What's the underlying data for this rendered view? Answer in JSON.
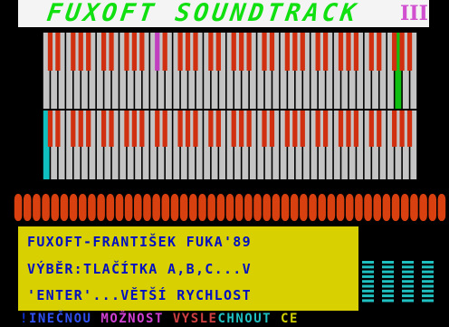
{
  "title": {
    "text": "FUXOFT SOUNDTRACK",
    "numeral": "III"
  },
  "colors": {
    "title_green": "#10e010",
    "title_numeral": "#d050d0",
    "white_key": "#c4c4c4",
    "black_key": "#d03010",
    "highlight_magenta": "#c040c0",
    "highlight_green": "#10c010",
    "highlight_cyan": "#10c0c0",
    "info_bg": "#d8d000",
    "info_text": "#0010c0",
    "meter": "#20c0c0"
  },
  "keyboards": [
    {
      "id": "upper",
      "white_highlight": {
        "key": 46,
        "color": "highlight_green"
      },
      "black_highlight": {
        "key": 10,
        "color": "highlight_magenta"
      }
    },
    {
      "id": "lower",
      "white_highlight": {
        "key": 0,
        "color": "highlight_cyan"
      },
      "black_highlight": null
    }
  ],
  "info": {
    "line1": "FUXOFT-FRANTIŠEK FUKA'89",
    "line2": "VÝBĚR:TLAČÍTKA A,B,C...V",
    "line3": "'ENTER'...VĚTŠÍ RYCHLOST"
  },
  "level_meter": {
    "bars": 4
  },
  "scroller": [
    {
      "text": "!",
      "color": "#1030d0"
    },
    {
      "text": "INEČNOU",
      "color": "#3050f0"
    },
    {
      "text": " ",
      "color": "#000"
    },
    {
      "text": "MOŽNOST",
      "color": "#d040d0"
    },
    {
      "text": " ",
      "color": "#000"
    },
    {
      "text": "VYSLE",
      "color": "#d04040"
    },
    {
      "text": "CHNOUT",
      "color": "#20c0c0"
    },
    {
      "text": " ",
      "color": "#000"
    },
    {
      "text": "CE",
      "color": "#d0d000"
    }
  ]
}
